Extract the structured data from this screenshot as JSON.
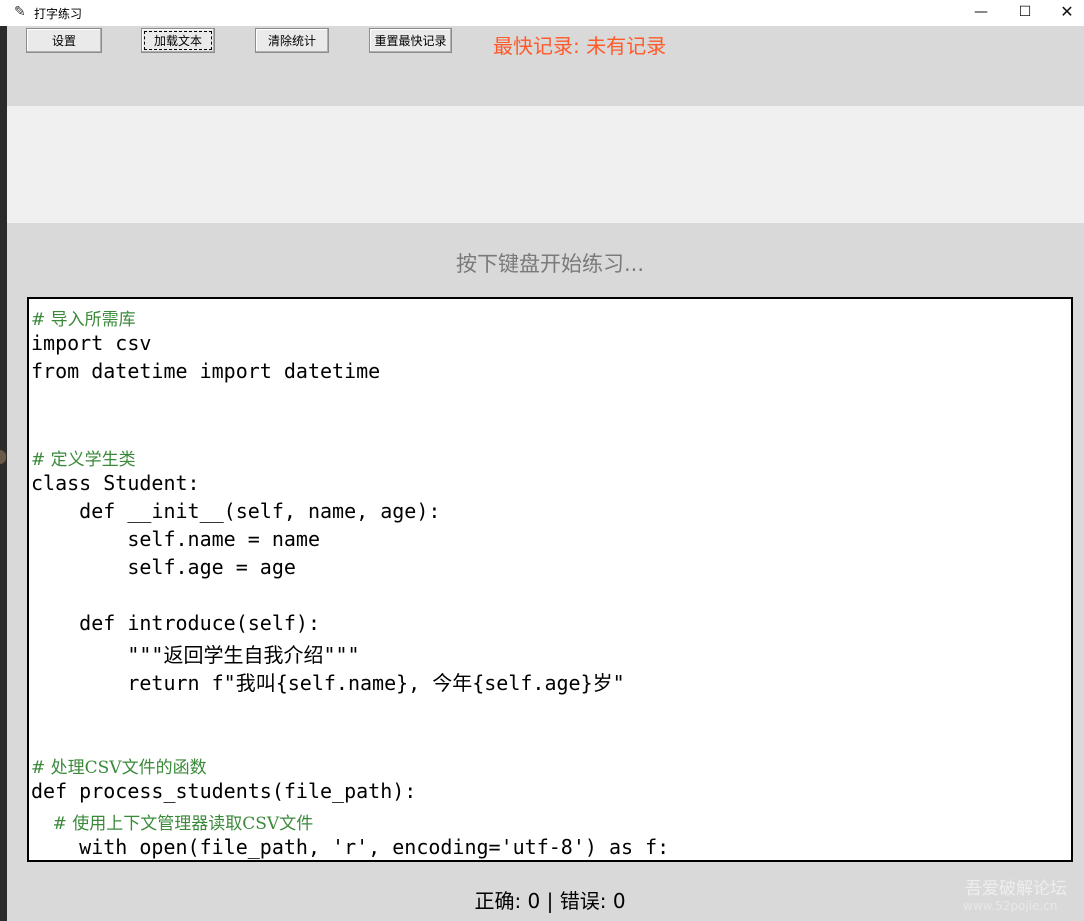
{
  "window": {
    "title": "打字练习",
    "app_icon": "feather-icon",
    "minimize": "—",
    "maximize": "☐",
    "close": "✕"
  },
  "toolbar": {
    "settings": "设置",
    "load_text": "加载文本",
    "clear_stats": "清除统计",
    "reset_best": "重置最快记录",
    "best_record": "最快记录: 未有记录",
    "best_record_color": "#ff5a2a"
  },
  "prompt": "按下键盘开始练习...",
  "code_lines": [
    {
      "text": "# 导入所需库",
      "type": "comment"
    },
    {
      "text": "import csv",
      "type": "code"
    },
    {
      "text": "from datetime import datetime",
      "type": "code"
    },
    {
      "text": "",
      "type": "blank"
    },
    {
      "text": "",
      "type": "blank"
    },
    {
      "text": "# 定义学生类",
      "type": "comment"
    },
    {
      "text": "class Student:",
      "type": "code"
    },
    {
      "text": "    def __init__(self, name, age):",
      "type": "code"
    },
    {
      "text": "        self.name = name",
      "type": "code"
    },
    {
      "text": "        self.age = age",
      "type": "code"
    },
    {
      "text": "",
      "type": "blank"
    },
    {
      "text": "    def introduce(self):",
      "type": "code"
    },
    {
      "text": "        \"\"\"返回学生自我介绍\"\"\"",
      "type": "code"
    },
    {
      "text": "        return f\"我叫{self.name}, 今年{self.age}岁\"",
      "type": "code"
    },
    {
      "text": "",
      "type": "blank"
    },
    {
      "text": "",
      "type": "blank"
    },
    {
      "text": "# 处理CSV文件的函数",
      "type": "comment"
    },
    {
      "text": "def process_students(file_path):",
      "type": "code"
    },
    {
      "text": "    # 使用上下文管理器读取CSV文件",
      "type": "comment"
    },
    {
      "text": "    with open(file_path, 'r', encoding='utf-8') as f:",
      "type": "code"
    }
  ],
  "status": "正确: 0 | 错误: 0",
  "watermark": {
    "line1": "吾爱破解论坛",
    "line2": "www.52pojie.cn"
  }
}
